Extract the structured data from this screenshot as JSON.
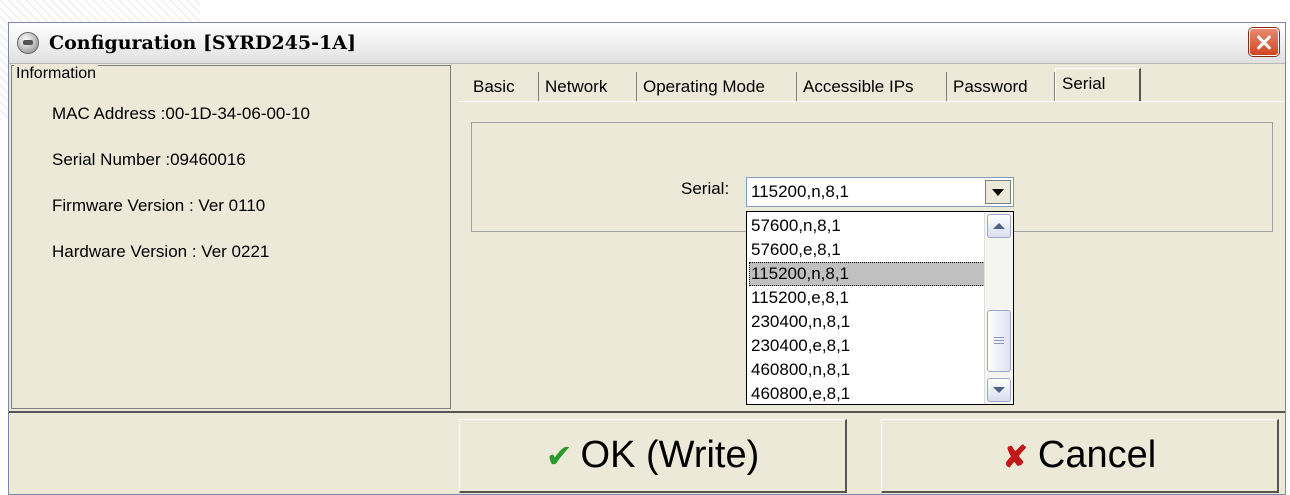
{
  "window": {
    "title": "Configuration [SYRD245-1A]"
  },
  "information": {
    "legend": "Information",
    "mac": "MAC Address :00-1D-34-06-00-10",
    "serial_number": "Serial Number :09460016",
    "firmware": "Firmware Version : Ver 0110",
    "hardware": "Hardware Version : Ver 0221"
  },
  "tabs": [
    {
      "label": "Basic"
    },
    {
      "label": "Network"
    },
    {
      "label": "Operating Mode"
    },
    {
      "label": "Accessible IPs"
    },
    {
      "label": "Password"
    },
    {
      "label": "Serial",
      "active": true
    }
  ],
  "serial": {
    "label": "Serial:",
    "value": "115200,n,8,1",
    "options": [
      "57600,n,8,1",
      "57600,e,8,1",
      "115200,n,8,1",
      "115200,e,8,1",
      "230400,n,8,1",
      "230400,e,8,1",
      "460800,n,8,1",
      "460800,e,8,1"
    ],
    "selected_index": 2
  },
  "buttons": {
    "ok": "OK (Write)",
    "ok_icon": "✔",
    "cancel": "Cancel",
    "cancel_icon": "✘"
  },
  "icons": {
    "app": "app-icon",
    "close": "close-icon",
    "ok": "checkmark-icon",
    "cancel": "x-mark-icon"
  },
  "colors": {
    "check": "#2a9a2a",
    "cancel_x": "#c21818",
    "selection": "#c0c0c0"
  }
}
